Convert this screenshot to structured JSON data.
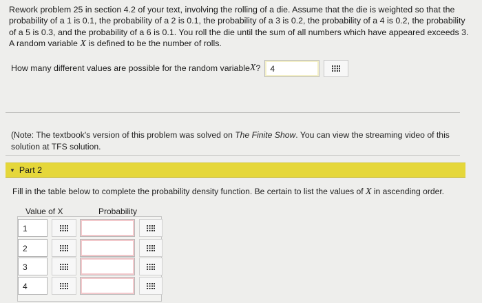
{
  "problem": {
    "text_before_x": "Rework problem 25 in section 4.2 of your text, involving the rolling of a die. Assume that the die is weighted so that the probability of a 1 is 0.1, the probability of a 2 is 0.1, the probability of a 3 is 0.2, the probability of a 4 is 0.2, the probability of a 5 is 0.3, and the probability of a 6 is 0.1. You roll the die until the sum of all numbers which have appeared exceeds 3. A random variable ",
    "var": "X",
    "text_after_x": " is defined to be the number of rolls."
  },
  "question": {
    "text": "How many different values are possible for the random variable ",
    "var": "X",
    "qmark": "?",
    "answer": "4"
  },
  "note": {
    "prefix": "(Note: The textbook's version of this problem was solved on ",
    "show": "The Finite Show",
    "suffix": ". You can view the streaming video of this solution at TFS solution."
  },
  "part2": {
    "label": "Part 2",
    "instruction_before": "Fill in the table below to complete the probability density function. Be certain to list the values of ",
    "var": "X",
    "instruction_after": " in ascending order.",
    "col_value": "Value of X",
    "col_prob": "Probability",
    "rows": [
      {
        "x": "1",
        "prob": ""
      },
      {
        "x": "2",
        "prob": ""
      },
      {
        "x": "3",
        "prob": ""
      },
      {
        "x": "4",
        "prob": ""
      }
    ]
  },
  "icons": {
    "grid": "grid-icon",
    "collapse": "triangle-down-icon"
  },
  "colors": {
    "part_bar": "#e5d73a",
    "answered_highlight": "#f4f0c8",
    "unanswered_highlight": "#f3c9cc"
  }
}
